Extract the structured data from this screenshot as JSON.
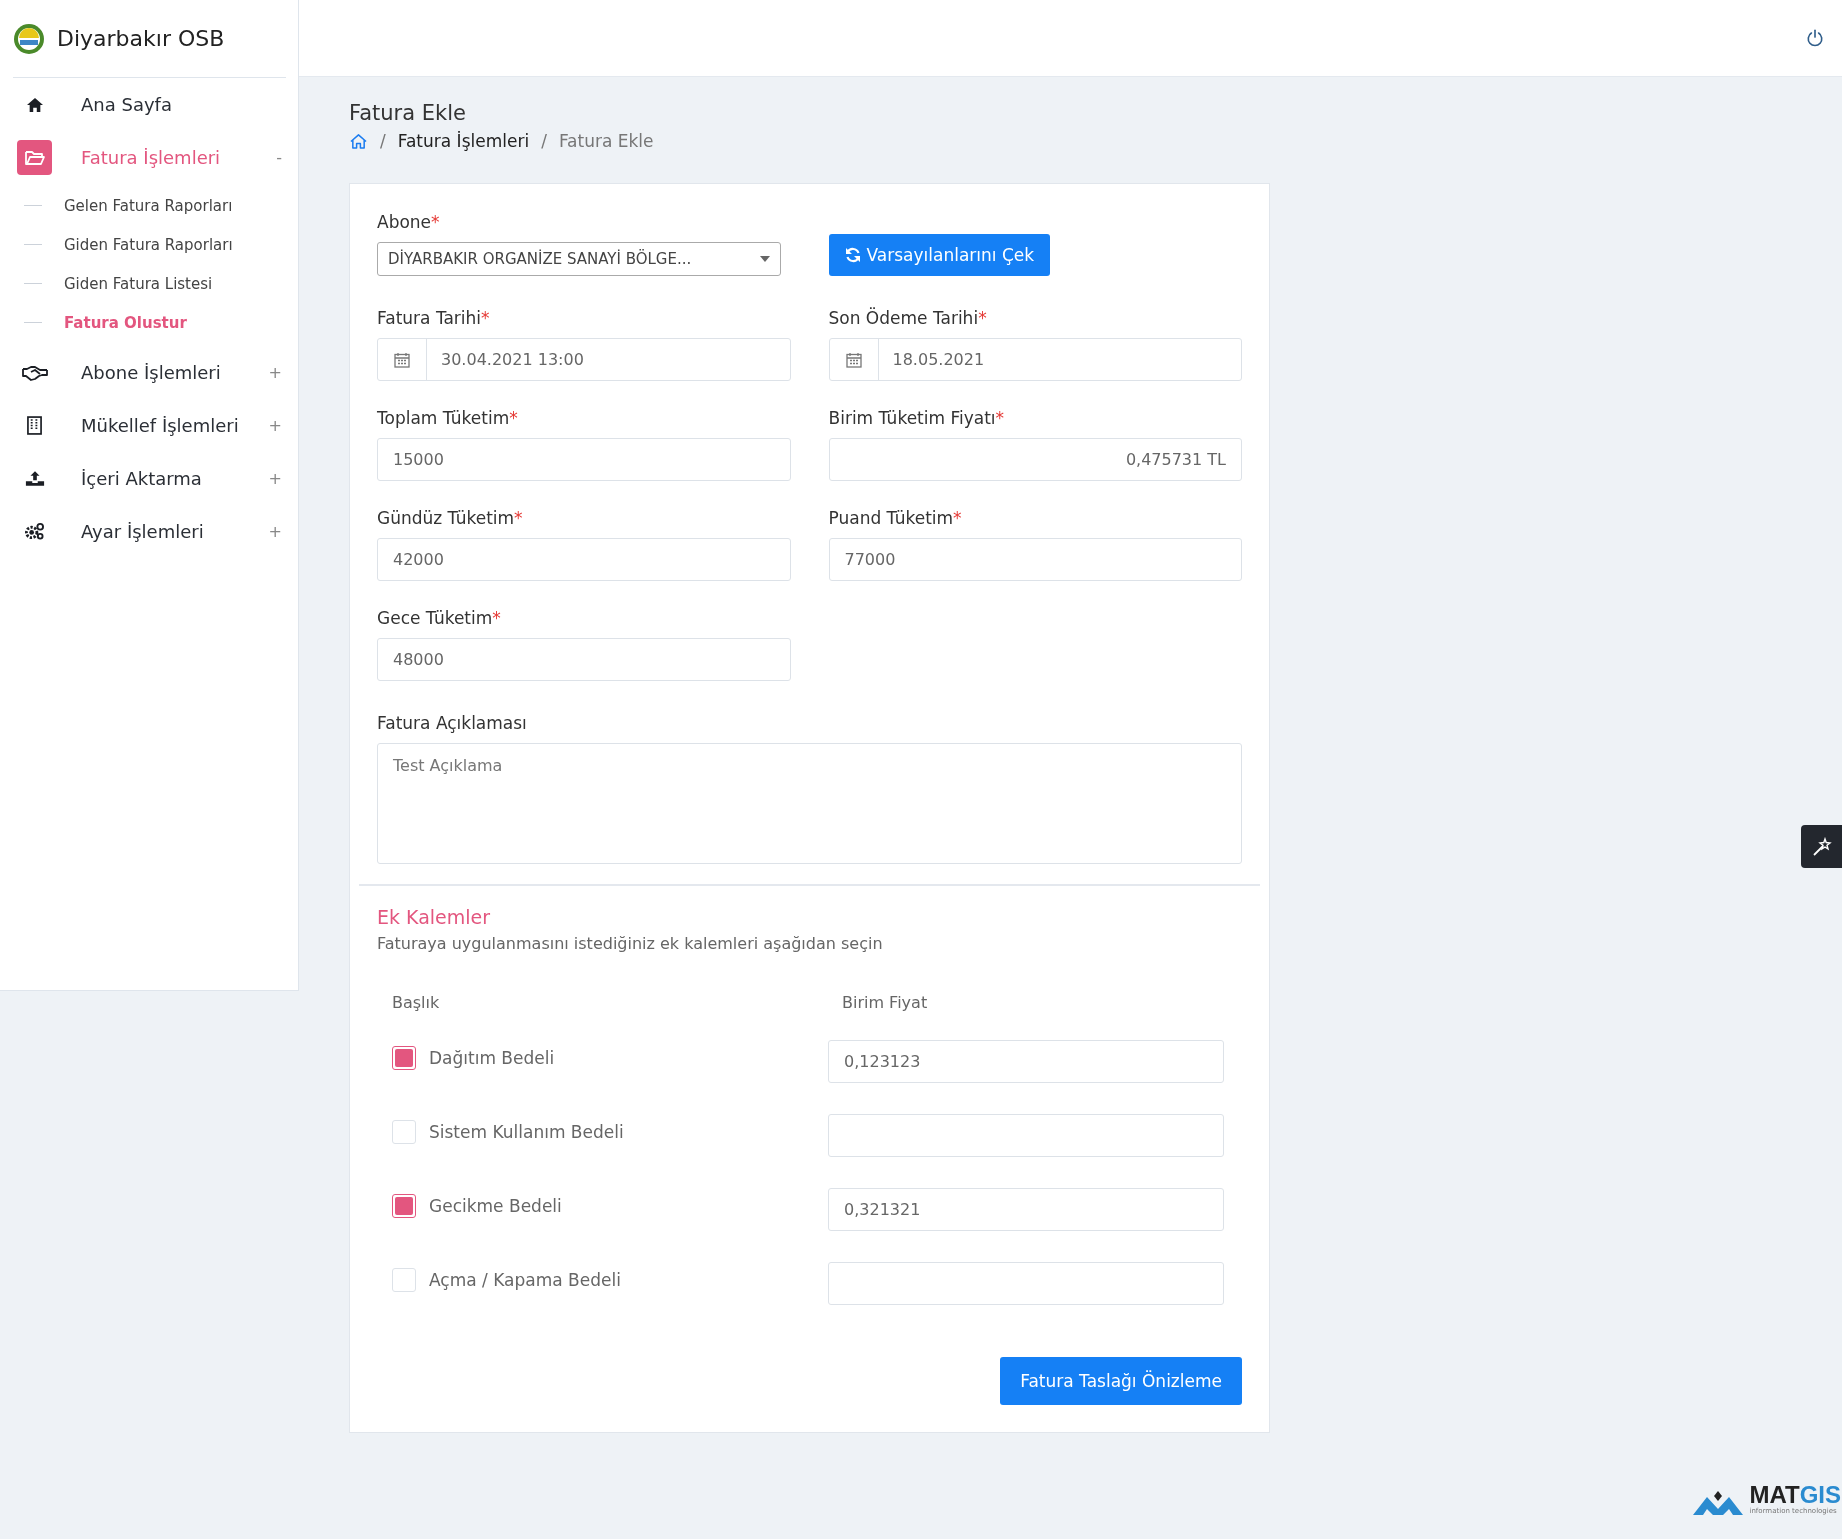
{
  "brand": {
    "name": "Diyarbakır OSB"
  },
  "sidebar": {
    "items": [
      {
        "label": "Ana Sayfa",
        "selected": false
      },
      {
        "label": "Fatura İşlemleri",
        "selected": true,
        "toggle": "-",
        "children": [
          {
            "label": "Gelen Fatura Raporları",
            "selected": false
          },
          {
            "label": "Giden Fatura Raporları",
            "selected": false
          },
          {
            "label": "Giden Fatura Listesi",
            "selected": false
          },
          {
            "label": "Fatura Olustur",
            "selected": true
          }
        ]
      },
      {
        "label": "Abone İşlemleri",
        "selected": false,
        "toggle": "+"
      },
      {
        "label": "Mükellef İşlemleri",
        "selected": false,
        "toggle": "+"
      },
      {
        "label": "İçeri Aktarma",
        "selected": false,
        "toggle": "+"
      },
      {
        "label": "Ayar İşlemleri",
        "selected": false,
        "toggle": "+"
      }
    ]
  },
  "page": {
    "title": "Fatura Ekle",
    "breadcrumb_separator": "/",
    "breadcrumb": [
      {
        "label": "Fatura İşlemleri",
        "selected": false
      },
      {
        "label": "Fatura Ekle",
        "selected": true
      }
    ]
  },
  "form": {
    "subscriber": {
      "label": "Abone",
      "required_mark": "*",
      "value": "DİYARBAKIR ORGANİZE SANAYİ BÖLGE..."
    },
    "defaults_button": "Varsayılanlarını Çek",
    "fields": [
      {
        "kind": "date",
        "label": "Fatura Tarihi",
        "required_mark": "*",
        "value": "30.04.2021 13:00"
      },
      {
        "kind": "date",
        "label": "Son Ödeme Tarihi",
        "required_mark": "*",
        "value": "18.05.2021"
      },
      {
        "kind": "text",
        "label": "Toplam Tüketim",
        "required_mark": "*",
        "value": "15000"
      },
      {
        "kind": "number",
        "label": "Birim Tüketim Fiyatı",
        "required_mark": "*",
        "value": "0,475731 TL"
      },
      {
        "kind": "text",
        "label": "Gündüz Tüketim",
        "required_mark": "*",
        "value": "42000"
      },
      {
        "kind": "text",
        "label": "Puand Tüketim",
        "required_mark": "*",
        "value": "77000"
      },
      {
        "kind": "text",
        "label": "Gece Tüketim",
        "required_mark": "*",
        "value": "48000"
      }
    ],
    "description": {
      "label": "Fatura Açıklaması",
      "value": "Test Açıklama"
    },
    "extras": {
      "title": "Ek Kalemler",
      "subtitle": "Faturaya uygulanmasını istediğiniz ek kalemleri aşağıdan seçin",
      "columns": [
        "Başlık",
        "Birim Fiyat"
      ],
      "items": [
        {
          "label": "Dağıtım Bedeli",
          "checked": true,
          "price": "0,123123"
        },
        {
          "label": "Sistem Kullanım Bedeli",
          "checked": false
        },
        {
          "label": "Gecikme Bedeli",
          "checked": true,
          "price": "0,321321"
        },
        {
          "label": "Açma / Kapama Bedeli",
          "checked": false
        }
      ]
    },
    "submit_button": "Fatura Taslağı Önizleme"
  },
  "footer_logo": {
    "name_dark": "MAT",
    "name_blue": "GIS",
    "tagline": "information technologies"
  }
}
